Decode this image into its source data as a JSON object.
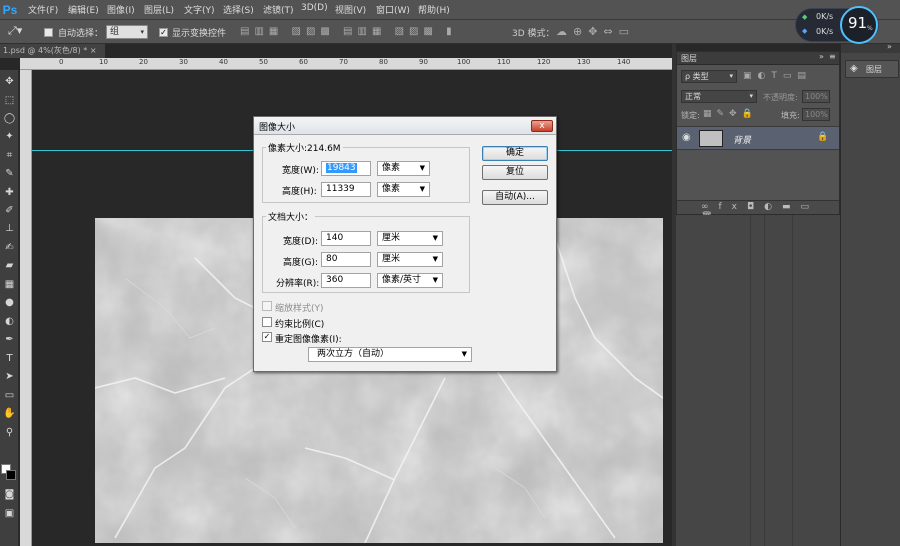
{
  "app": {
    "logo": "Ps"
  },
  "menu": [
    "文件(F)",
    "编辑(E)",
    "图像(I)",
    "图层(L)",
    "文字(Y)",
    "选择(S)",
    "滤镜(T)",
    "3D(D)",
    "视图(V)",
    "窗口(W)",
    "帮助(H)"
  ],
  "options": {
    "auto_select_label": "自动选择：",
    "auto_select_value": "组",
    "show_transform_label": "显示变换控件",
    "mode_3d_label": "3D 模式："
  },
  "network": {
    "up": "0K/s",
    "down": "0K/s",
    "percent": "91",
    "percent_unit": "%"
  },
  "document": {
    "tab_title": "1.psd @ 4%(灰色/8) *",
    "tab_close": "×"
  },
  "ruler": {
    "h_labels": [
      "0",
      "10",
      "20",
      "30",
      "40",
      "50",
      "60",
      "70",
      "80",
      "90",
      "100",
      "110",
      "120",
      "130",
      "140"
    ]
  },
  "dialog": {
    "title": "图像大小",
    "close": "x",
    "pixel_group_title": "像素大小:214.6M",
    "width_label": "宽度(W):",
    "width_value": "19843",
    "width_unit": "像素",
    "height_label": "高度(H):",
    "height_value": "11339",
    "height_unit": "像素",
    "doc_group_title": "文档大小：",
    "doc_width_label": "宽度(D):",
    "doc_width_value": "140",
    "doc_width_unit": "厘米",
    "doc_height_label": "高度(G):",
    "doc_height_value": "80",
    "doc_height_unit": "厘米",
    "resolution_label": "分辨率(R):",
    "resolution_value": "360",
    "resolution_unit": "像素/英寸",
    "scale_styles": "缩放样式(Y)",
    "constrain": "约束比例(C)",
    "resample": "重定图像像素(I):",
    "resample_method": "两次立方（自动）",
    "ok": "确定",
    "reset": "复位",
    "auto": "自动(A)..."
  },
  "layers_panel": {
    "tab": "图层",
    "filter_kind": "ρ 类型",
    "blend_mode": "正常",
    "opacity_label": "不透明度:",
    "opacity_value": "100%",
    "lock_label": "锁定:",
    "fill_label": "填充:",
    "fill_value": "100%",
    "layer_name": "背景"
  },
  "side_tabs": {
    "layers": "图层"
  }
}
